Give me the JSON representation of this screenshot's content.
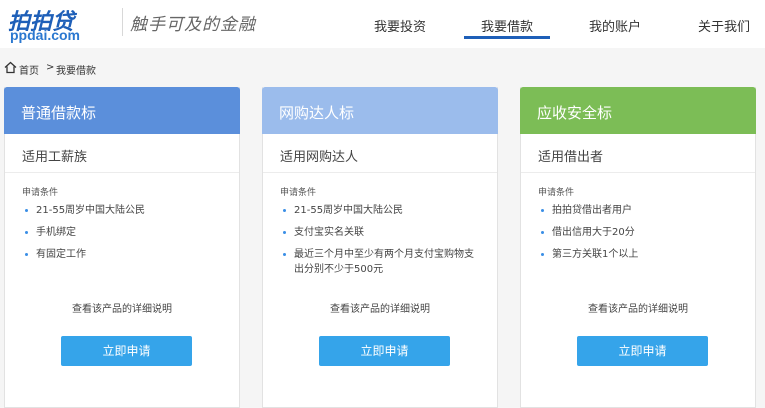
{
  "header": {
    "logo_main": "拍拍贷",
    "logo_sub": "ppdai.com",
    "slogan": "触手可及的金融",
    "nav": [
      {
        "label": "我要投资"
      },
      {
        "label": "我要借款"
      },
      {
        "label": "我的账户"
      },
      {
        "label": "关于我们"
      }
    ],
    "active_nav_index": 1
  },
  "breadcrumb": {
    "home": "首页",
    "separator": ">",
    "current": "我要借款"
  },
  "colors": {
    "card1_head": "#5b8fdb",
    "card2_head": "#9bbcec",
    "card3_head": "#7cbd56",
    "button": "#35a4ea",
    "nav_active_underline": "#1e5fb8"
  },
  "cards": [
    {
      "title": "普通借款标",
      "subtitle": "适用工薪族",
      "conditions_label": "申请条件",
      "conditions": [
        "21-55周岁中国大陆公民",
        "手机绑定",
        "有固定工作"
      ],
      "detail_link": "查看该产品的详细说明",
      "apply_label": "立即申请"
    },
    {
      "title": "网购达人标",
      "subtitle": "适用网购达人",
      "conditions_label": "申请条件",
      "conditions": [
        "21-55周岁中国大陆公民",
        "支付宝实名关联",
        "最近三个月中至少有两个月支付宝购物支出分别不少于500元"
      ],
      "detail_link": "查看该产品的详细说明",
      "apply_label": "立即申请"
    },
    {
      "title": "应收安全标",
      "subtitle": "适用借出者",
      "conditions_label": "申请条件",
      "conditions": [
        "拍拍贷借出者用户",
        "借出信用大于20分",
        "第三方关联1个以上"
      ],
      "detail_link": "查看该产品的详细说明",
      "apply_label": "立即申请"
    }
  ]
}
